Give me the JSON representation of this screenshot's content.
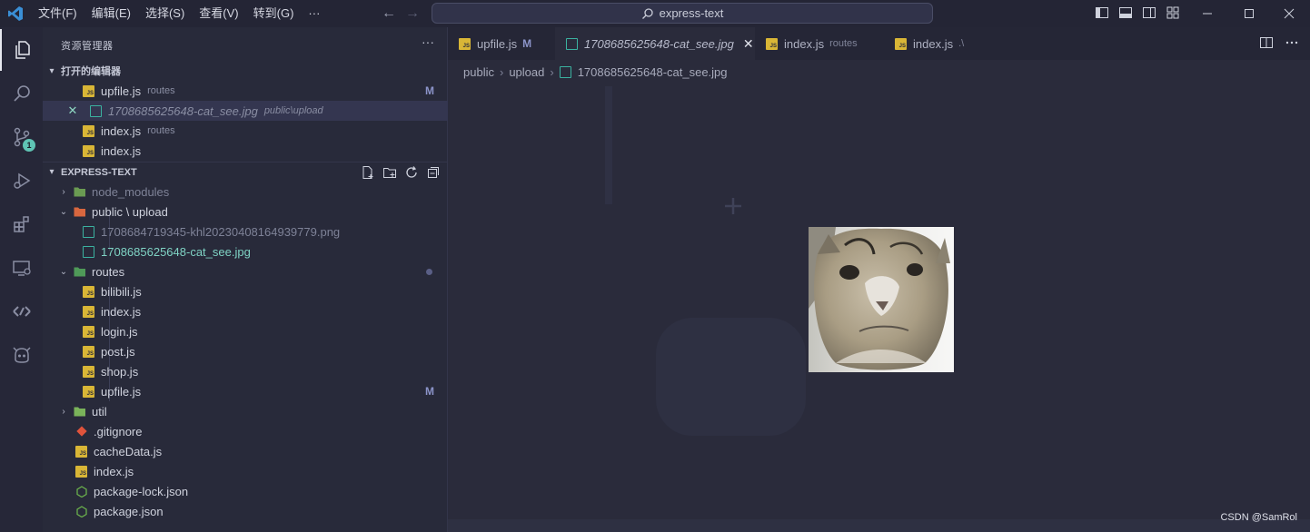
{
  "titlebar": {
    "menu": [
      "文件(F)",
      "编辑(E)",
      "选择(S)",
      "查看(V)",
      "转到(G)",
      "···"
    ],
    "command_center": "express-text"
  },
  "activity": {
    "scm_badge": "1"
  },
  "sidebar": {
    "title": "资源管理器",
    "more": "···",
    "open_editors": {
      "heading": "打开的编辑器",
      "items": [
        {
          "name": "upfile.js",
          "desc": "routes",
          "status": "M"
        },
        {
          "name": "1708685625648-cat_see.jpg",
          "desc": "public\\upload"
        },
        {
          "name": "index.js",
          "desc": "routes"
        },
        {
          "name": "index.js",
          "desc": ""
        }
      ]
    },
    "explorer": {
      "heading": "EXPRESS-TEXT",
      "items": [
        {
          "name": "node_modules"
        },
        {
          "name": "public \\ upload"
        },
        {
          "name": "1708684719345-khl20230408164939779.png"
        },
        {
          "name": "1708685625648-cat_see.jpg"
        },
        {
          "name": "routes"
        },
        {
          "name": "bilibili.js"
        },
        {
          "name": "index.js"
        },
        {
          "name": "login.js"
        },
        {
          "name": "post.js"
        },
        {
          "name": "shop.js"
        },
        {
          "name": "upfile.js",
          "status": "M"
        },
        {
          "name": "util"
        },
        {
          "name": ".gitignore"
        },
        {
          "name": "cacheData.js"
        },
        {
          "name": "index.js"
        },
        {
          "name": "package-lock.json"
        },
        {
          "name": "package.json"
        }
      ]
    }
  },
  "editor": {
    "tabs": [
      {
        "name": "upfile.js",
        "desc": "",
        "status": "M"
      },
      {
        "name": "1708685625648-cat_see.jpg",
        "desc": "",
        "close": "✕"
      },
      {
        "name": "index.js",
        "desc": "routes"
      },
      {
        "name": "index.js",
        "desc": ".\\"
      }
    ],
    "breadcrumb": [
      "public",
      "upload",
      "1708685625648-cat_see.jpg"
    ]
  },
  "watermark": "CSDN @SamRol",
  "colors": {
    "accent": "#3bb2a0",
    "js": "#d9b636",
    "modified": "#8c94c9"
  }
}
